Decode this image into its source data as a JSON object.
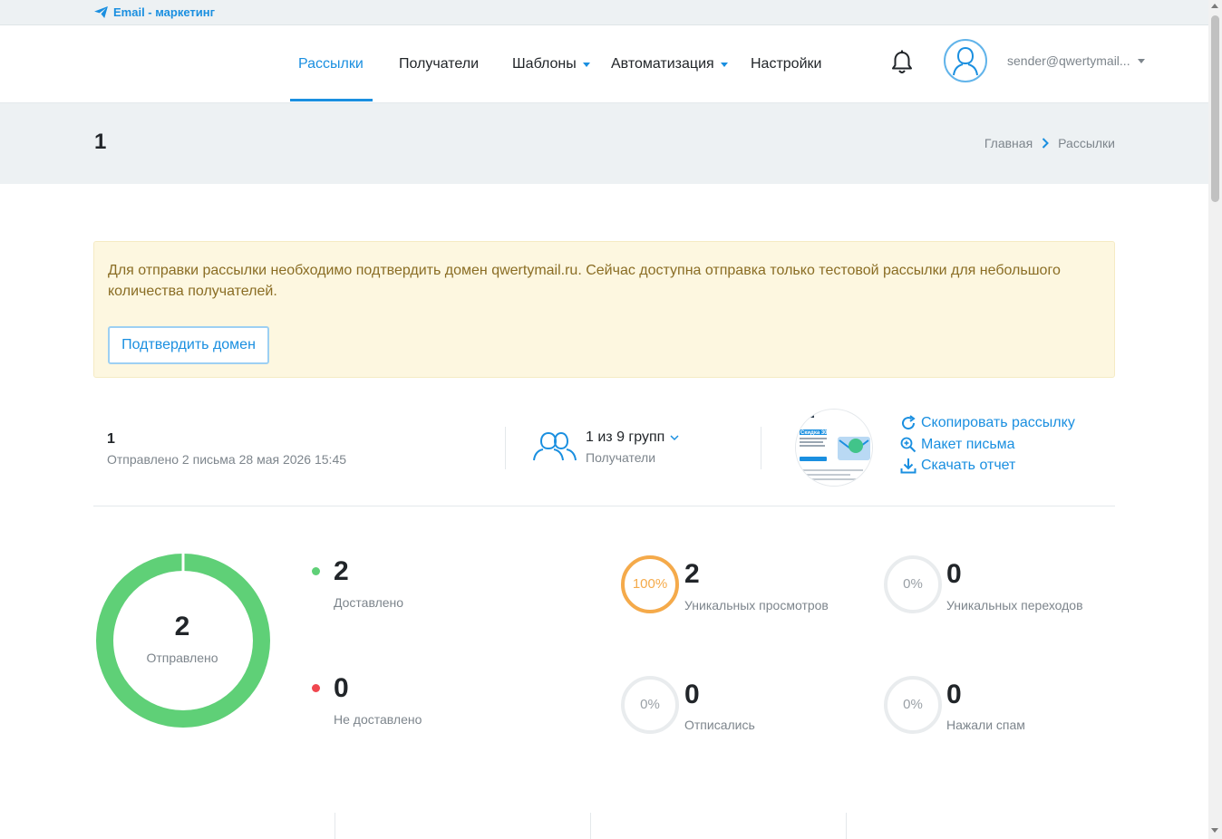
{
  "topbar": {
    "brand_label": "Email - маркетинг"
  },
  "nav": {
    "items": [
      {
        "label": "Рассылки",
        "active": true
      },
      {
        "label": "Получатели"
      },
      {
        "label": "Шаблоны",
        "dropdown": true
      },
      {
        "label": "Автоматизация",
        "dropdown": true
      },
      {
        "label": "Настройки"
      }
    ],
    "user_email": "sender@qwertymail..."
  },
  "page": {
    "title": "1",
    "breadcrumb": [
      "Главная",
      "Рассылки"
    ]
  },
  "alert": {
    "text": "Для отправки рассылки необходимо подтвердить домен qwertymail.ru. Сейчас доступна отправка только тестовой рассылки для небольшого количества получателей.",
    "button_label": "Подтвердить домен"
  },
  "campaign": {
    "name": "1",
    "sent_info": "Отправлено 2 письма 28 мая 2026 15:45",
    "groups": "1 из 9 групп",
    "recipients_label": "Получатели",
    "thumbnail_text": "Скидка 30%",
    "actions": {
      "copy": "Скопировать рассылку",
      "layout": "Макет письма",
      "download": "Скачать отчет"
    }
  },
  "stats": {
    "sent": {
      "value": "2",
      "label": "Отправлено",
      "fraction": 1.0
    },
    "delivered": {
      "value": "2",
      "label": "Доставлено"
    },
    "not_delivered": {
      "value": "0",
      "label": "Не доставлено"
    },
    "unique_views": {
      "value": "2",
      "label": "Уникальных просмотров",
      "percent": "100%",
      "fraction": 1.0
    },
    "unique_clicks": {
      "value": "0",
      "label": "Уникальных переходов",
      "percent": "0%",
      "fraction": 0
    },
    "unsubscribed": {
      "value": "0",
      "label": "Отписались",
      "percent": "0%",
      "fraction": 0
    },
    "spam": {
      "value": "0",
      "label": "Нажали спам",
      "percent": "0%",
      "fraction": 0
    }
  },
  "colors": {
    "accent": "#1a8fe0",
    "green": "#5fd077",
    "red": "#f0474f",
    "orange": "#f5aa4a",
    "ring_empty": "#e9ecee",
    "alert_bg": "#fdf7e0"
  }
}
